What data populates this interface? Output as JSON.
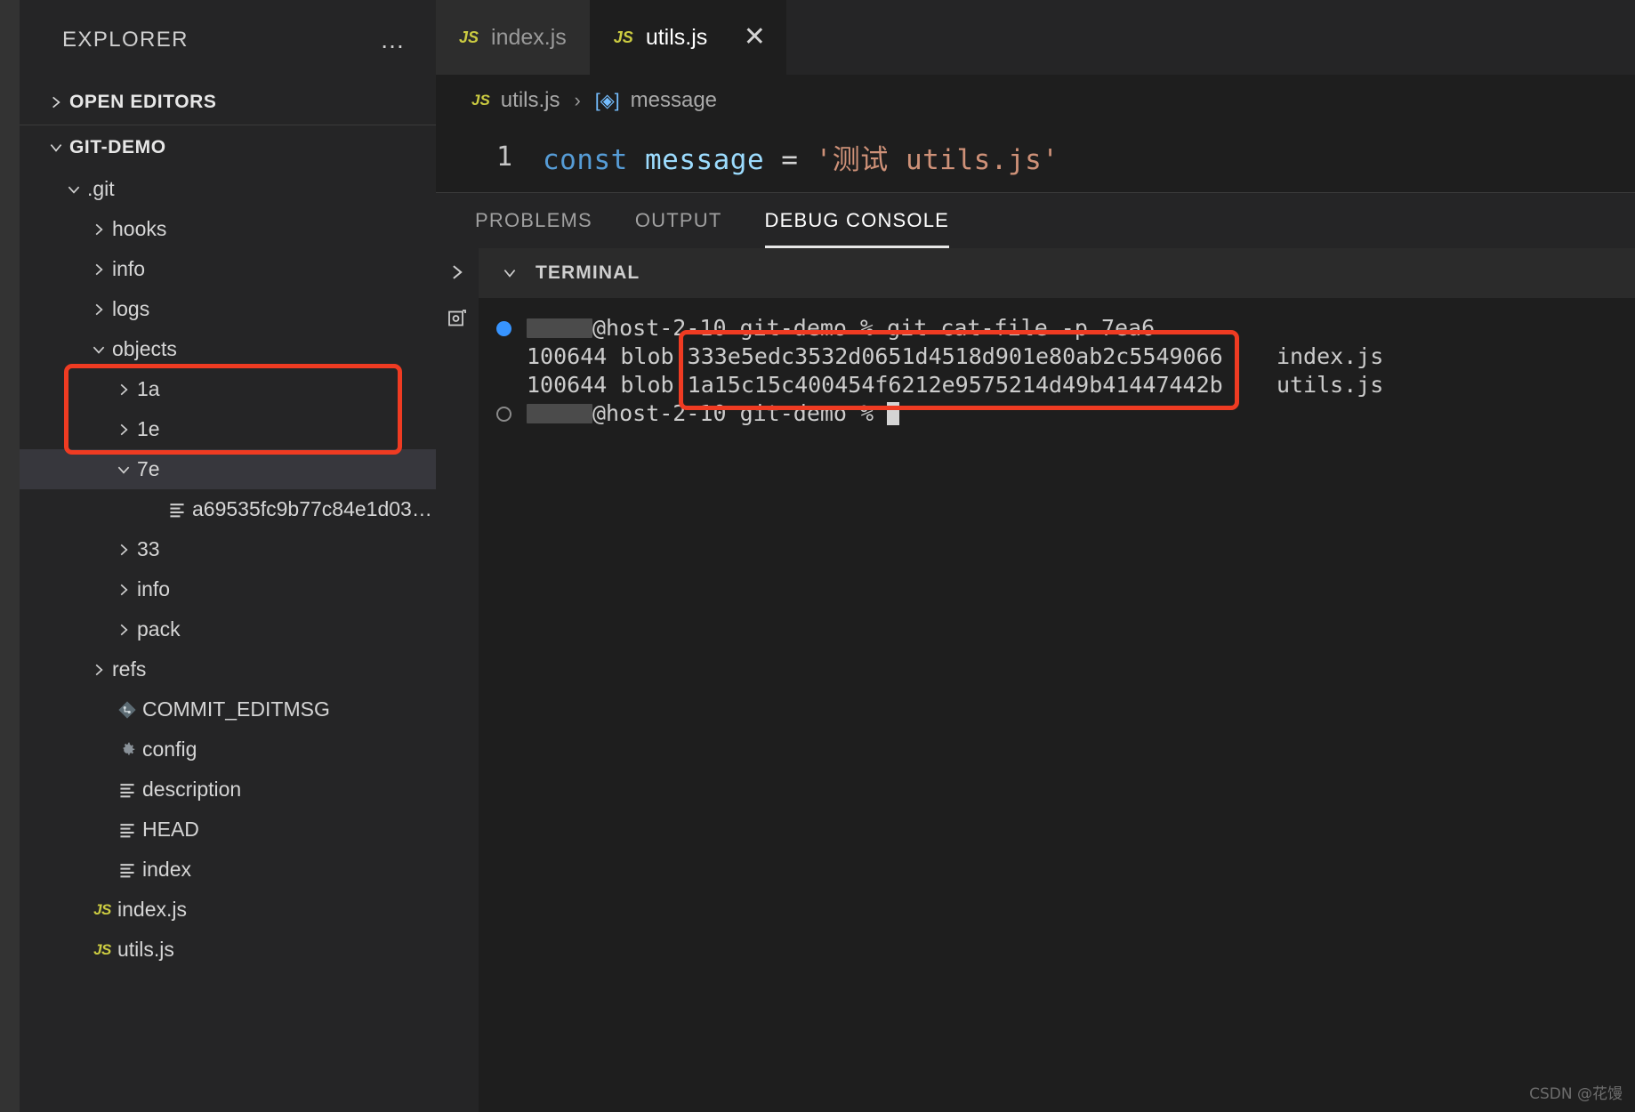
{
  "sidebar": {
    "header": {
      "title": "EXPLORER",
      "more_actions": "…"
    },
    "open_editors_label": "OPEN EDITORS",
    "workspace_label": "GIT-DEMO",
    "tree": [
      {
        "label": ".git",
        "depth": 1,
        "kind": "folder-open",
        "selected": false
      },
      {
        "label": "hooks",
        "depth": 2,
        "kind": "folder",
        "selected": false
      },
      {
        "label": "info",
        "depth": 2,
        "kind": "folder",
        "selected": false
      },
      {
        "label": "logs",
        "depth": 2,
        "kind": "folder",
        "selected": false
      },
      {
        "label": "objects",
        "depth": 2,
        "kind": "folder-open",
        "selected": false
      },
      {
        "label": "1a",
        "depth": 3,
        "kind": "folder",
        "selected": false
      },
      {
        "label": "1e",
        "depth": 3,
        "kind": "folder",
        "selected": false
      },
      {
        "label": "7e",
        "depth": 3,
        "kind": "folder-open",
        "selected": true
      },
      {
        "label": "a69535fc9b77c84e1d033…",
        "depth": 4,
        "kind": "file",
        "selected": false
      },
      {
        "label": "33",
        "depth": 3,
        "kind": "folder",
        "selected": false
      },
      {
        "label": "info",
        "depth": 3,
        "kind": "folder",
        "selected": false
      },
      {
        "label": "pack",
        "depth": 3,
        "kind": "folder",
        "selected": false
      },
      {
        "label": "refs",
        "depth": 2,
        "kind": "folder",
        "selected": false
      },
      {
        "label": "COMMIT_EDITMSG",
        "depth": 2,
        "kind": "git",
        "selected": false
      },
      {
        "label": "config",
        "depth": 2,
        "kind": "gear",
        "selected": false
      },
      {
        "label": "description",
        "depth": 2,
        "kind": "file",
        "selected": false
      },
      {
        "label": "HEAD",
        "depth": 2,
        "kind": "file",
        "selected": false
      },
      {
        "label": "index",
        "depth": 2,
        "kind": "file",
        "selected": false
      },
      {
        "label": "index.js",
        "depth": 1,
        "kind": "js",
        "selected": false
      },
      {
        "label": "utils.js",
        "depth": 1,
        "kind": "js",
        "selected": false
      }
    ]
  },
  "editor": {
    "tabs": [
      {
        "label": "index.js",
        "icon": "js-icon",
        "active": false,
        "closable": false
      },
      {
        "label": "utils.js",
        "icon": "js-icon",
        "active": true,
        "closable": true
      }
    ],
    "close_glyph": "✕",
    "breadcrumb": {
      "file": "utils.js",
      "separator": "›",
      "symbol": "message",
      "symbol_glyph": "[◈]"
    },
    "line_number": "1",
    "code": {
      "keyword": "const",
      "identifier": " message",
      "operator": " = ",
      "string": "'测试 utils.js'"
    }
  },
  "panel": {
    "tabs": [
      {
        "label": "PROBLEMS",
        "active": false
      },
      {
        "label": "OUTPUT",
        "active": false
      },
      {
        "label": "DEBUG CONSOLE",
        "active": true
      }
    ],
    "terminal_section_label": "TERMINAL",
    "terminal_lines": [
      {
        "type": "prompt",
        "bullet": "filled",
        "redacted": true,
        "text": "@host-2-10 git-demo % git cat-file -p 7ea6"
      },
      {
        "type": "output",
        "mode": "100644",
        "kind": "blob",
        "hash": "333e5edc3532d0651d4518d901e80ab2c5549066",
        "name": "index.js"
      },
      {
        "type": "output",
        "mode": "100644",
        "kind": "blob",
        "hash": "1a15c15c400454f6212e9575214d49b41447442b",
        "name": "utils.js"
      },
      {
        "type": "prompt",
        "bullet": "hollow",
        "redacted": true,
        "text": "@host-2-10 git-demo % ",
        "cursor": true
      }
    ]
  },
  "annotations": {
    "accent_color": "#ef3b22",
    "sidebar_box_note": "highlights objects subfolders 1a and 1e",
    "terminal_box_note": "highlights the two blob SHA-1 hashes"
  },
  "watermark": "CSDN @花馒"
}
